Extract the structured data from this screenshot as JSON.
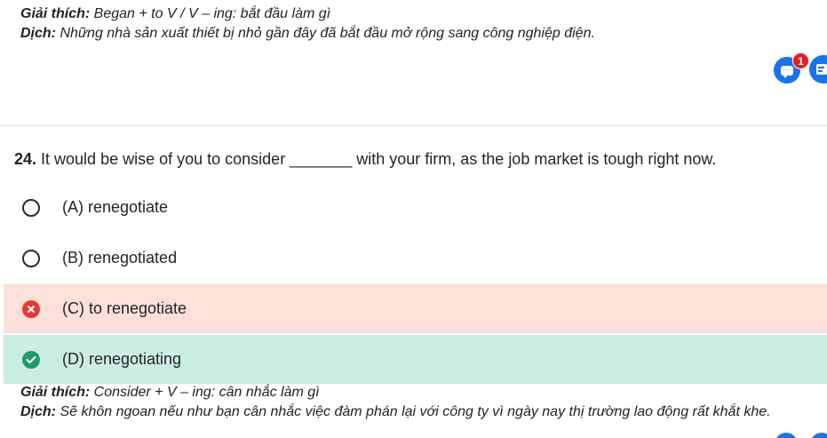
{
  "previous_explanation": {
    "giai_thich_label": "Giải thích:",
    "giai_thich_text": " Began + to V / V – ing: bắt đầu làm gì",
    "dich_label": "Dịch:",
    "dich_text": " Những nhà sản xuất thiết bị nhỏ gần đây đã bắt đầu mở rộng sang công nghiệp điện."
  },
  "floating": {
    "chat_icon_glyph": "···",
    "badge_count": "1",
    "chat_icon": "chat-bubble-icon",
    "form_icon": "form-icon",
    "accent_color": "#1a73e8",
    "badge_color": "#e51c23"
  },
  "question": {
    "number": "24.",
    "text": " It would be wise of you to consider _______ with your firm, as the job market is tough right now."
  },
  "options": [
    {
      "label": "(A) renegotiate",
      "state": "unselected"
    },
    {
      "label": "(B) renegotiated",
      "state": "unselected"
    },
    {
      "label": "(C) to renegotiate",
      "state": "wrong",
      "color": "#fde0da"
    },
    {
      "label": "(D) renegotiating",
      "state": "correct",
      "color": "#ccede3"
    }
  ],
  "explanation": {
    "giai_thich_label": "Giải thích:",
    "giai_thich_text": " Consider + V – ing: cân nhắc làm gì",
    "dich_label": "Dịch:",
    "dich_text": " Sẽ khôn ngoan nếu như bạn cân nhắc việc đàm phán lại với công ty vì ngày nay thị trường lao động rất khắt khe."
  }
}
